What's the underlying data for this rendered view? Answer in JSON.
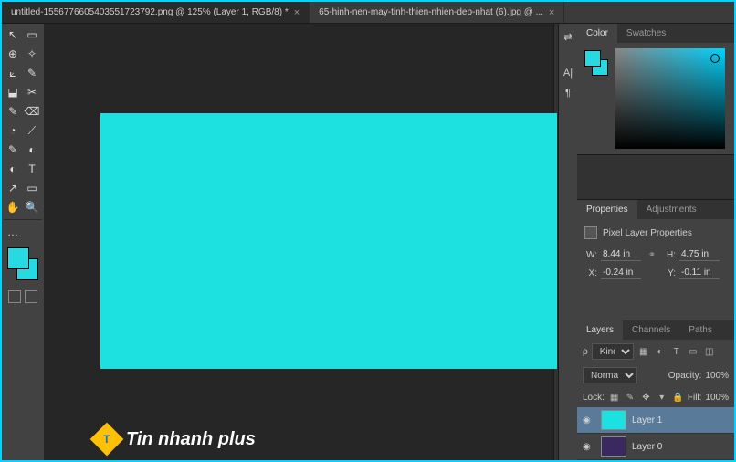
{
  "tabs": [
    {
      "title": "untitled-1556776605403551723792.png @ 125% (Layer 1, RGB/8) *"
    },
    {
      "title": "65-hinh-nen-may-tinh-thien-nhien-dep-nhat (6).jpg @ ..."
    }
  ],
  "vbtns": {
    "i0": "⇄",
    "i1": "A|",
    "i2": "¶"
  },
  "color_panel": {
    "tab_color": "Color",
    "tab_swatches": "Swatches"
  },
  "props_panel": {
    "tab_props": "Properties",
    "tab_adj": "Adjustments",
    "title": "Pixel Layer Properties",
    "w_lbl": "W:",
    "w_val": "8.44 in",
    "h_lbl": "H:",
    "h_val": "4.75 in",
    "x_lbl": "X:",
    "x_val": "-0.24 in",
    "y_lbl": "Y:",
    "y_val": "-0.11 in"
  },
  "layers_panel": {
    "tab_layers": "Layers",
    "tab_channels": "Channels",
    "tab_paths": "Paths",
    "kind": "Kind",
    "mode": "Normal",
    "opacity_lbl": "Opacity:",
    "opacity": "100%",
    "lock_lbl": "Lock:",
    "fill_lbl": "Fill:",
    "fill": "100%",
    "layer1": "Layer 1",
    "layer0": "Layer 0"
  },
  "watermark": "Tin nhanh plus",
  "tools": [
    "↖",
    "▭",
    "⊕",
    "✧",
    "⟀",
    "✎",
    "⬓",
    "✂",
    "✎",
    "⌫",
    "◔",
    "⟋",
    "✎",
    "◐",
    "◐",
    "T",
    "↗",
    "▭",
    "✋",
    "🔍",
    "…"
  ]
}
